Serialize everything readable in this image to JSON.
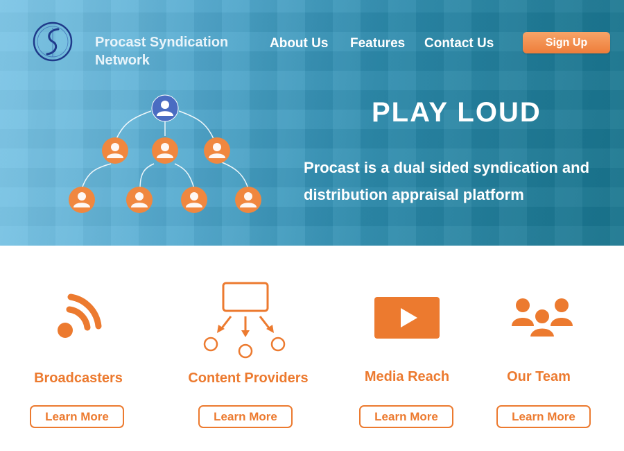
{
  "brand": {
    "name_line1": "Procast Syndication",
    "name_line2": "Network"
  },
  "nav": {
    "items": [
      {
        "label": "About Us"
      },
      {
        "label": "Features"
      },
      {
        "label": "Contact Us"
      }
    ],
    "signup_label": "Sign Up"
  },
  "hero": {
    "headline": "PLAY LOUD",
    "tagline": "Procast is a dual sided syndication and distribution appraisal platform"
  },
  "features": [
    {
      "title": "Broadcasters",
      "icon": "rss-icon",
      "button": "Learn More"
    },
    {
      "title": "Content Providers",
      "icon": "distribution-icon",
      "button": "Learn More"
    },
    {
      "title": "Media Reach",
      "icon": "video-play-icon",
      "button": "Learn More"
    },
    {
      "title": "Our Team",
      "icon": "team-icon",
      "button": "Learn More"
    }
  ],
  "colors": {
    "accent": "#ec7a2f",
    "hero_start": "#7fc3e2",
    "hero_end": "#1f7f9a",
    "org_top_node": "#4a6cc2",
    "org_node": "#f0873f"
  }
}
